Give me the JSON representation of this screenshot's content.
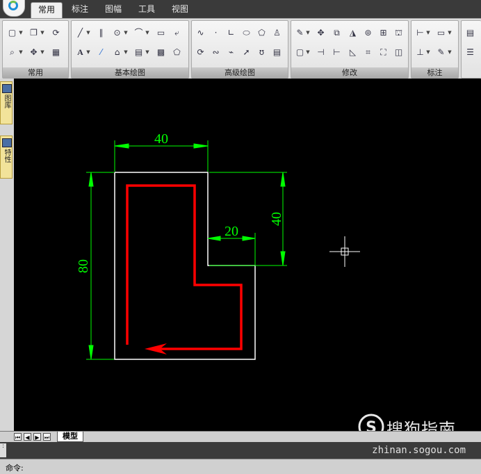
{
  "tabs": [
    "常用",
    "标注",
    "图幅",
    "工具",
    "视图"
  ],
  "active_tab": "常用",
  "ribbon": {
    "panels": [
      {
        "title": "常用"
      },
      {
        "title": "基本绘图"
      },
      {
        "title": "高级绘图"
      },
      {
        "title": "修改"
      },
      {
        "title": "标注"
      }
    ]
  },
  "sidebar": {
    "tabs": [
      "图库",
      "特性"
    ]
  },
  "drawing": {
    "dimensions": [
      "40",
      "40",
      "20",
      "80"
    ],
    "colors": {
      "outline": "#ffffff",
      "dimension": "#00ff00",
      "path": "#ff0000",
      "background": "#000000"
    }
  },
  "model_tab": "模型",
  "command_label": "命令:",
  "watermark": {
    "brand": "搜狗指南",
    "url": "zhinan.sogou.com"
  }
}
